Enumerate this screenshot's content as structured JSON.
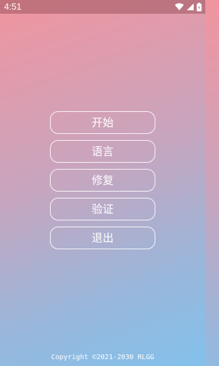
{
  "status_bar": {
    "time": "4:51",
    "icons": [
      "wifi-icon",
      "signal-icon",
      "battery-icon"
    ]
  },
  "menu": {
    "start_label": "开始",
    "language_label": "语言",
    "repair_label": "修复",
    "verify_label": "验证",
    "exit_label": "退出"
  },
  "footer": {
    "copyright": "Copyright ©2021-2030 RLGG"
  },
  "colors": {
    "gradient_top_left": "#f1949f",
    "gradient_bottom_right": "#82c1eb",
    "button_border": "#ffffff",
    "text": "#ffffff"
  }
}
